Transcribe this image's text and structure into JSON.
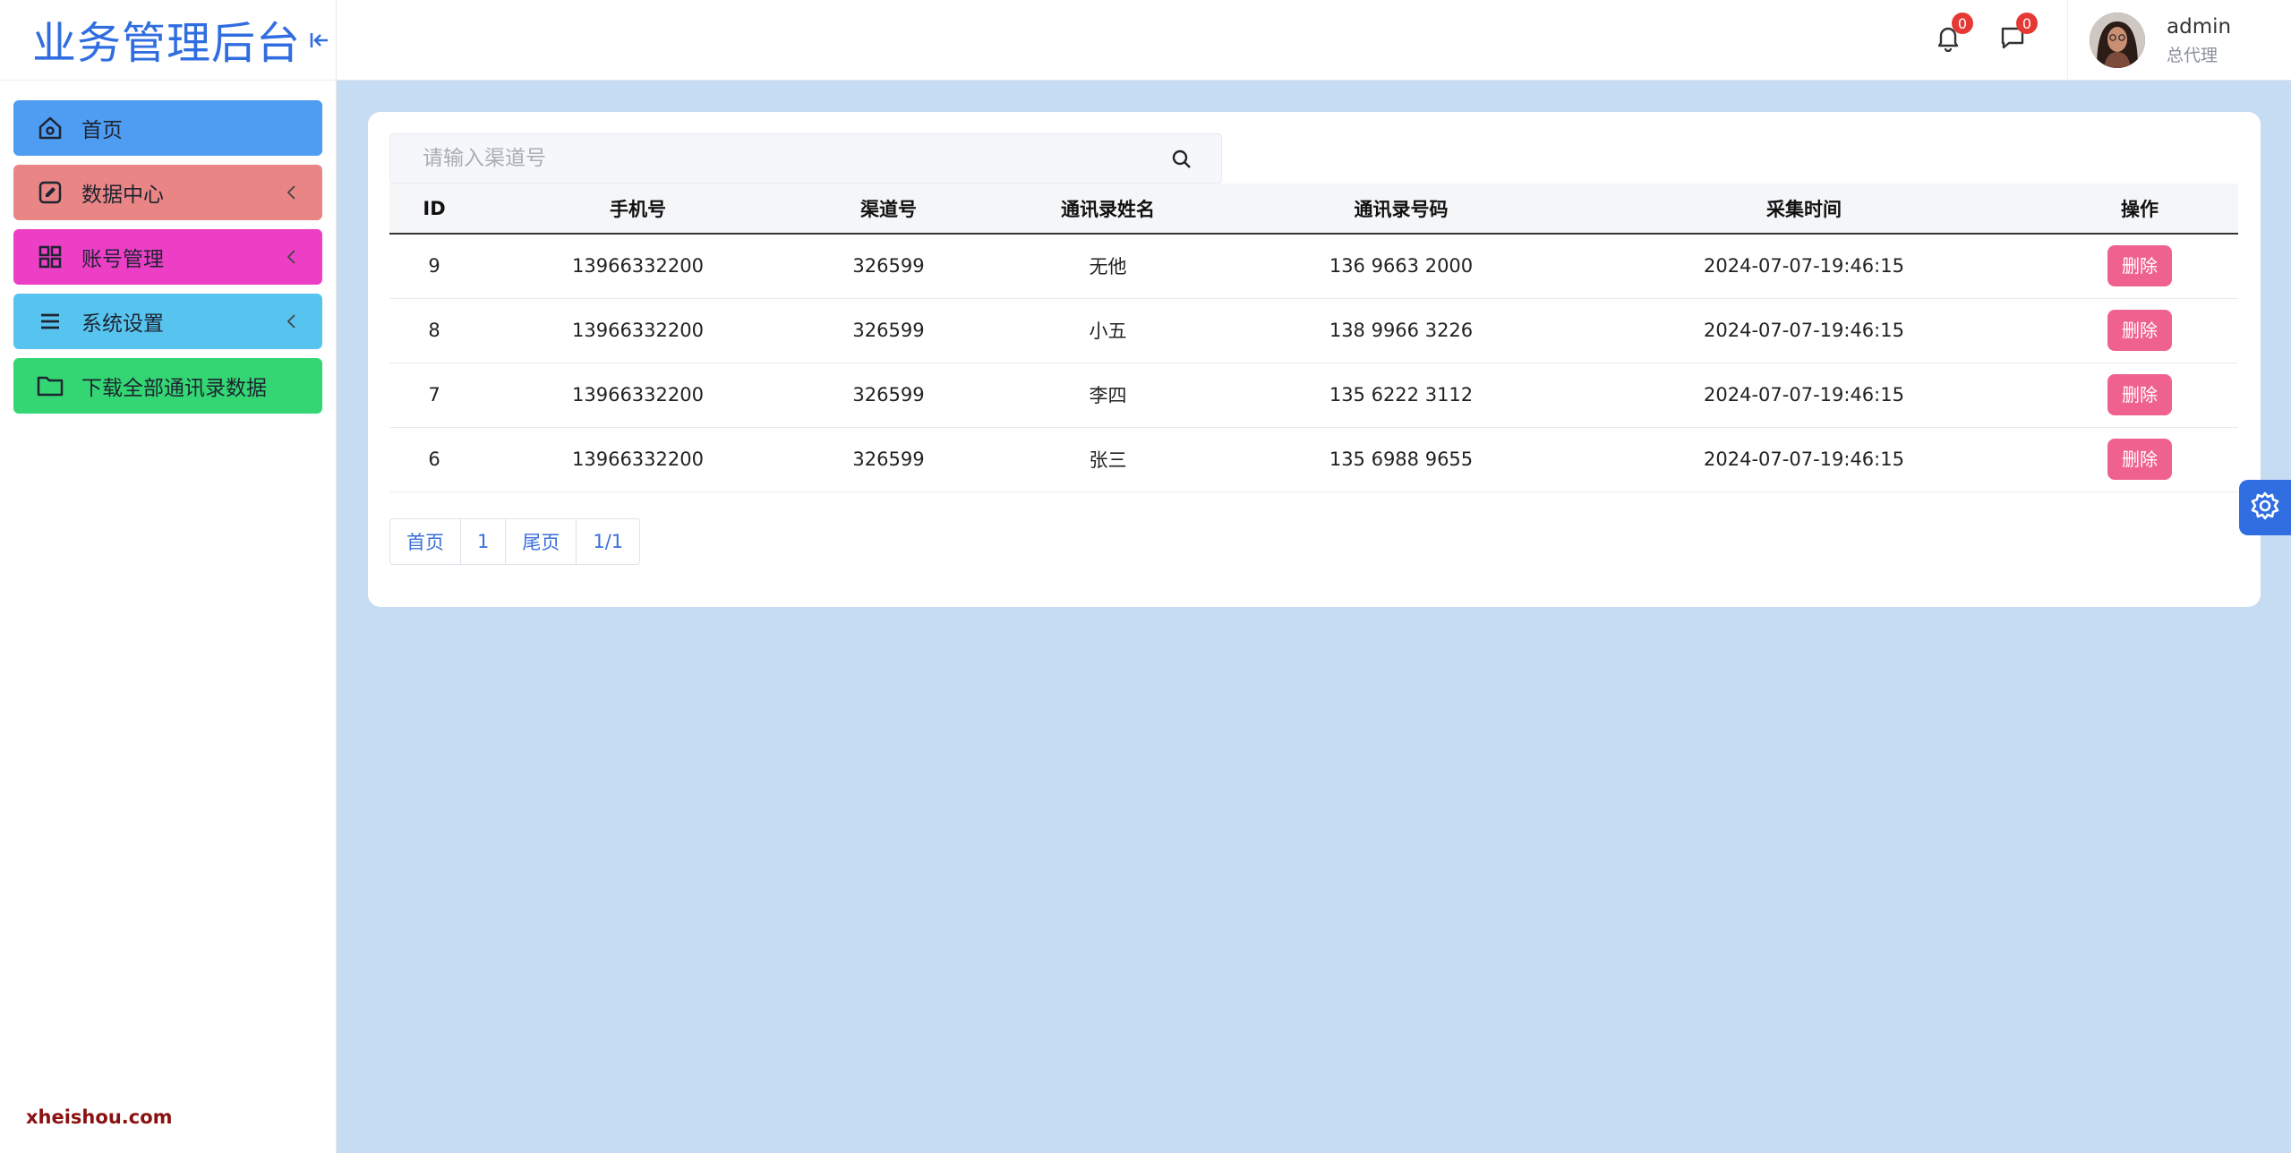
{
  "brand": {
    "title": "业务管理后台",
    "collapse_icon": "collapse-left-icon"
  },
  "sidebar": {
    "items": [
      {
        "label": "首页",
        "icon": "home-icon",
        "color": "#4f9cf3",
        "has_chevron": false
      },
      {
        "label": "数据中心",
        "icon": "edit-icon",
        "color": "#ea8585",
        "has_chevron": true
      },
      {
        "label": "账号管理",
        "icon": "grid-icon",
        "color": "#ec3fc6",
        "has_chevron": true
      },
      {
        "label": "系统设置",
        "icon": "menu-icon",
        "color": "#57c4f0",
        "has_chevron": true
      },
      {
        "label": "下载全部通讯录数据",
        "icon": "folder-icon",
        "color": "#33d673",
        "has_chevron": false
      }
    ],
    "footer": "xheishou.com"
  },
  "header": {
    "notifications": {
      "icon": "bell-icon",
      "count": "0"
    },
    "messages": {
      "icon": "message-icon",
      "count": "0"
    },
    "user": {
      "name": "admin",
      "role": "总代理"
    }
  },
  "search": {
    "placeholder": "请输入渠道号",
    "value": "",
    "icon": "search-icon"
  },
  "table": {
    "columns": [
      "ID",
      "手机号",
      "渠道号",
      "通讯录姓名",
      "通讯录号码",
      "采集时间",
      "操作"
    ],
    "rows": [
      {
        "id": "9",
        "phone": "13966332200",
        "channel": "326599",
        "name": "无他",
        "contact": "136 9663 2000",
        "time": "2024-07-07-19:46:15",
        "action": "删除"
      },
      {
        "id": "8",
        "phone": "13966332200",
        "channel": "326599",
        "name": "小五",
        "contact": "138 9966 3226",
        "time": "2024-07-07-19:46:15",
        "action": "删除"
      },
      {
        "id": "7",
        "phone": "13966332200",
        "channel": "326599",
        "name": "李四",
        "contact": "135 6222 3112",
        "time": "2024-07-07-19:46:15",
        "action": "删除"
      },
      {
        "id": "6",
        "phone": "13966332200",
        "channel": "326599",
        "name": "张三",
        "contact": "135 6988 9655",
        "time": "2024-07-07-19:46:15",
        "action": "删除"
      }
    ]
  },
  "pager": {
    "first": "首页",
    "current": "1",
    "last": "尾页",
    "summary": "1/1"
  },
  "colors": {
    "accent": "#2f6de0",
    "delete": "#f0628e",
    "page_bg": "#c6dcf2"
  },
  "settings_fab": {
    "icon": "gear-icon"
  }
}
